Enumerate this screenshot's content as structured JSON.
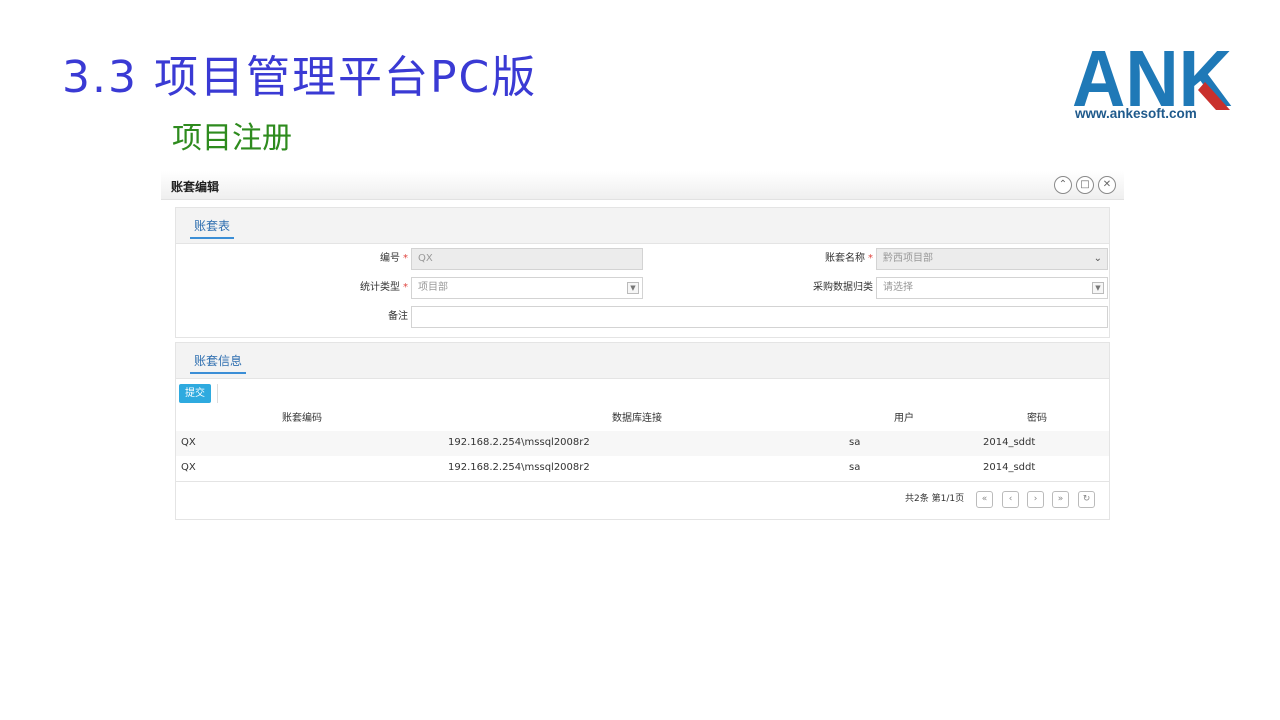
{
  "slide": {
    "title": "3.3 项目管理平台PC版",
    "subtitle": "项目注册",
    "logo": {
      "text": "ANK",
      "url": "www.ankesoft.com",
      "colors": {
        "blue": "#1f79b7",
        "red": "#c9302c"
      }
    }
  },
  "window": {
    "title": "账套编辑",
    "controls": [
      {
        "icon": "collapse-icon",
        "glyph": "⌃"
      },
      {
        "icon": "maximize-icon",
        "glyph": "□"
      },
      {
        "icon": "close-icon",
        "glyph": "✕"
      }
    ]
  },
  "form_panel": {
    "tab": "账套表",
    "fields": {
      "code": {
        "label": "编号",
        "required": "*",
        "value": "QX"
      },
      "name": {
        "label": "账套名称",
        "required": "*",
        "value": "黔西项目部"
      },
      "stat_type": {
        "label": "统计类型",
        "required": "*",
        "value": "项目部"
      },
      "purchase_category": {
        "label": "采购数据归类",
        "placeholder": "请选择"
      },
      "remark": {
        "label": "备注",
        "value": ""
      }
    }
  },
  "info_panel": {
    "tab": "账套信息",
    "submit_label": "提交",
    "columns": [
      "账套编码",
      "数据库连接",
      "用户",
      "密码"
    ],
    "rows": [
      [
        "QX",
        "192.168.2.254\\mssql2008r2",
        "sa",
        "2014_sddt"
      ],
      [
        "QX",
        "192.168.2.254\\mssql2008r2",
        "sa",
        "2014_sddt"
      ]
    ],
    "pager": {
      "info": "共2条 第1/1页",
      "buttons": [
        {
          "icon": "first-page-icon",
          "glyph": "«"
        },
        {
          "icon": "prev-page-icon",
          "glyph": "‹"
        },
        {
          "icon": "next-page-icon",
          "glyph": "›"
        },
        {
          "icon": "last-page-icon",
          "glyph": "»"
        },
        {
          "icon": "refresh-icon",
          "glyph": "↻"
        }
      ]
    }
  },
  "colors": {
    "title": "#3a3ad4",
    "subtitle": "#2e8b1e",
    "accent": "#2eaadf",
    "tab": "#2f6fb0",
    "required": "#e0443e"
  }
}
